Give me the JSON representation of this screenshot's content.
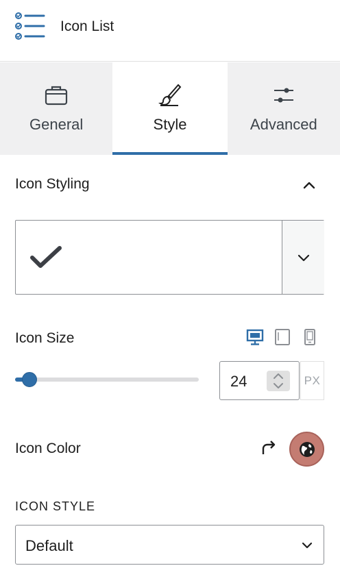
{
  "header": {
    "title": "Icon List",
    "icon": "list-check-icon"
  },
  "tabs": [
    {
      "label": "General",
      "icon": "briefcase-icon",
      "active": false
    },
    {
      "label": "Style",
      "icon": "brush-icon",
      "active": true
    },
    {
      "label": "Advanced",
      "icon": "sliders-icon",
      "active": false
    }
  ],
  "icon_styling": {
    "title": "Icon Styling",
    "selected_icon": "checkmark-icon"
  },
  "icon_size": {
    "label": "Icon Size",
    "device": "desktop",
    "value": "24",
    "slider_fraction": 0.08,
    "unit": "PX"
  },
  "icon_color": {
    "label": "Icon Color",
    "swatch_color": "#c47c72"
  },
  "icon_style": {
    "label": "ICON STYLE",
    "value": "Default"
  },
  "colors": {
    "accent": "#2f6ea8",
    "tab_bg": "#f0f0f1"
  }
}
